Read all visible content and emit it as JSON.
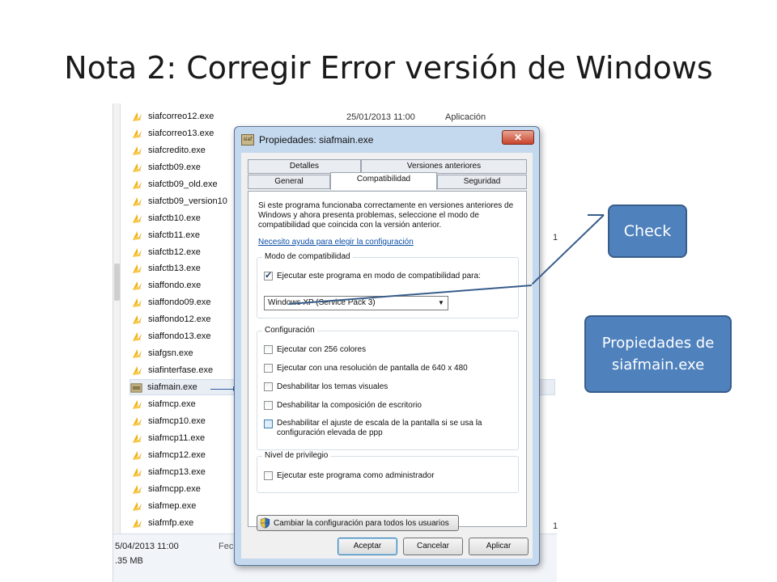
{
  "slide": {
    "title": "Nota 2: Corregir Error versión de Windows"
  },
  "explorer": {
    "files": [
      "siafcorreo12.exe",
      "siafcorreo13.exe",
      "siafcredito.exe",
      "siafctb09.exe",
      "siafctb09_old.exe",
      "siafctb09_version10",
      "siafctb10.exe",
      "siafctb11.exe",
      "siafctb12.exe",
      "siafctb13.exe",
      "siaffondo.exe",
      "siaffondo09.exe",
      "siaffondo12.exe",
      "siaffondo13.exe",
      "siafgsn.exe",
      "siafinterfase.exe",
      "siafmain.exe",
      "siafmcp.exe",
      "siafmcp10.exe",
      "siafmcp11.exe",
      "siafmcp12.exe",
      "siafmcp13.exe",
      "siafmcpp.exe",
      "siafmep.exe",
      "siafmfp.exe"
    ],
    "selected_file": "siafmain.exe",
    "first_row_date": "25/01/2013 11:00",
    "first_row_type": "Aplicación",
    "stray_right_1": "1",
    "stray_right_2": "1",
    "status_date": "5/04/2013 11:00",
    "status_label_partial": "Fec",
    "status_size": ".35 MB"
  },
  "dialog": {
    "app_icon_text": "siaf",
    "title": "Propiedades: siafmain.exe",
    "close_glyph": "✕",
    "tabs": {
      "detalles": "Detalles",
      "versiones": "Versiones anteriores",
      "general": "General",
      "compatibilidad": "Compatibilidad",
      "seguridad": "Seguridad"
    },
    "intro": "Si este programa funcionaba correctamente en versiones anteriores de Windows y ahora presenta problemas, seleccione el modo de compatibilidad que coincida con la versión anterior.",
    "help_link": "Necesito ayuda para elegir la configuración",
    "compat_group": {
      "label": "Modo de compatibilidad",
      "checkbox": "Ejecutar este programa en modo de compatibilidad para:",
      "checked": true,
      "select_value": "Windows XP (Service Pack 3)"
    },
    "config_group": {
      "label": "Configuración",
      "options": [
        "Ejecutar con 256 colores",
        "Ejecutar con una resolución de pantalla de 640 x 480",
        "Deshabilitar los temas visuales",
        "Deshabilitar la composición de escritorio",
        "Deshabilitar el ajuste de escala de la pantalla si se usa la configuración elevada de ppp"
      ]
    },
    "privilege_group": {
      "label": "Nivel de privilegio",
      "option": "Ejecutar este programa como administrador"
    },
    "change_button": "Cambiar la configuración para todos los usuarios",
    "buttons": {
      "ok": "Aceptar",
      "cancel": "Cancelar",
      "apply": "Aplicar"
    }
  },
  "callouts": {
    "check": "Check",
    "props": "Propiedades de siafmain.exe"
  },
  "colors": {
    "callout_fill": "#4f81bd",
    "callout_border": "#385d8a",
    "link": "#0b4fa8"
  }
}
